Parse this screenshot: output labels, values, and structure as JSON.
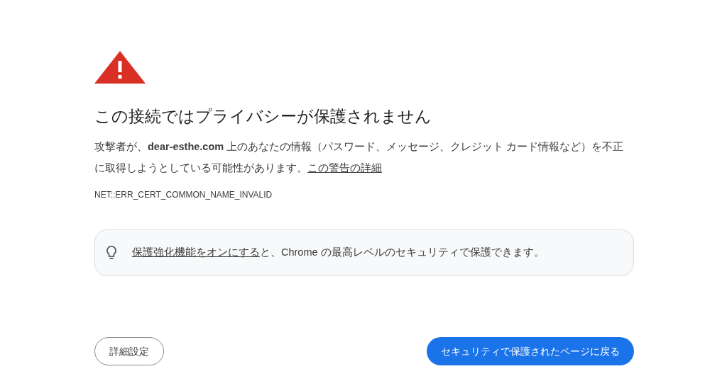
{
  "title": "この接続ではプライバシーが保護されません",
  "message": {
    "text": "攻撃者が、**dear-esthe.com** 上のあなたの情報（パスワード、メッセージ、クレジット カード情報など）を不正に取得しようとしている可能性があります。",
    "link": "この警告の詳細"
  },
  "error_code": "NET::ERR_CERT_COMMON_NAME_INVALID",
  "tip": {
    "link": "保護強化機能をオンにする",
    "text": "と、Chrome の最高レベルのセキュリティで保護できます。"
  },
  "buttons": [
    {
      "kind": "secondary",
      "label": "詳細設定"
    },
    {
      "kind": "primary",
      "label": "セキュリティで保護されたページに戻る"
    }
  ]
}
